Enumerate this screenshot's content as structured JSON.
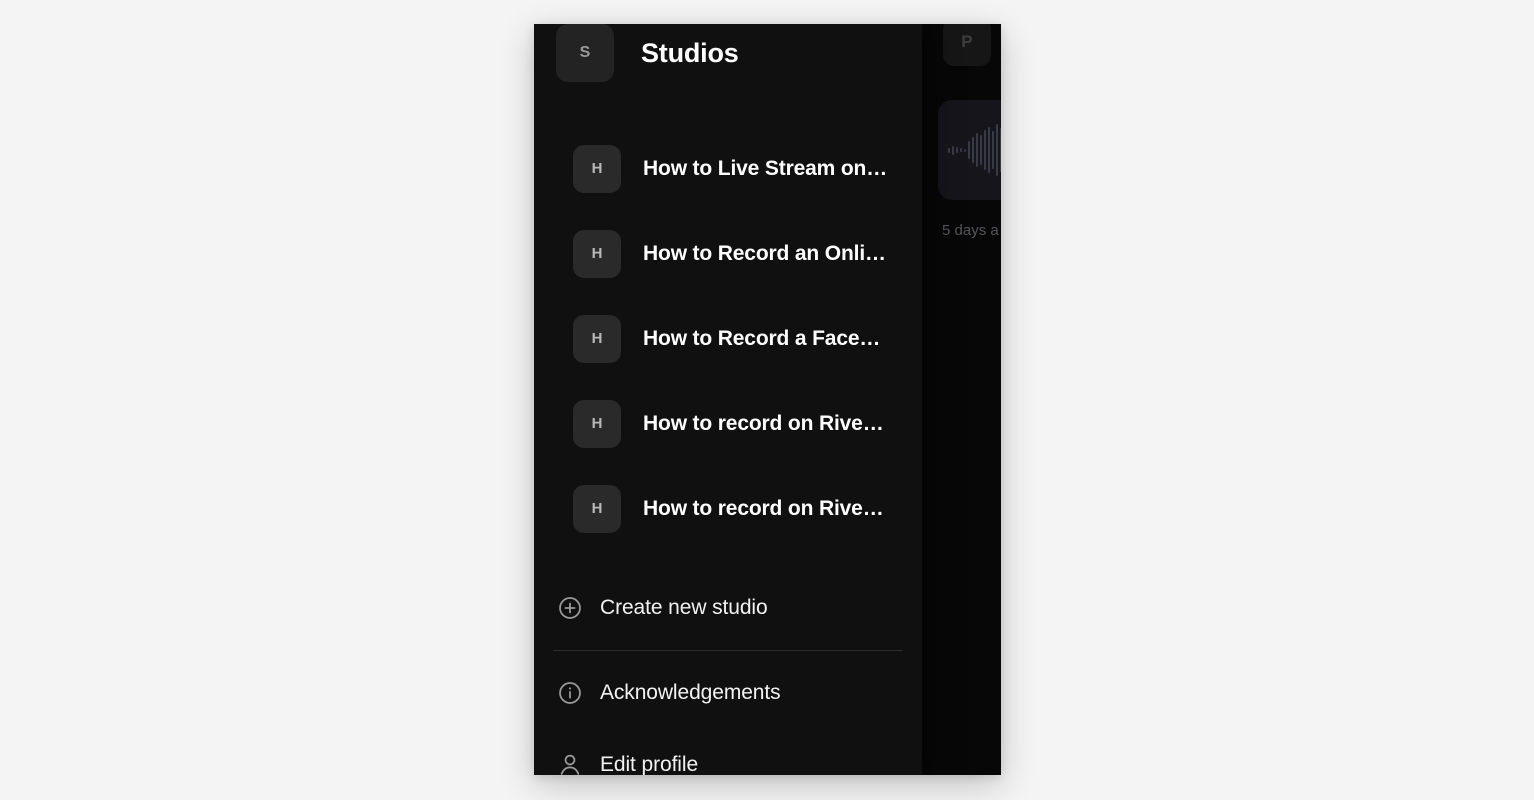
{
  "menu": {
    "header": {
      "avatar_initial": "S",
      "title": "Studios"
    },
    "studios": [
      {
        "badge": "H",
        "label": "How to Live Stream on…"
      },
      {
        "badge": "H",
        "label": "How to Record an Onli…"
      },
      {
        "badge": "H",
        "label": "How to Record a Face…"
      },
      {
        "badge": "H",
        "label": "How to record on Rive…"
      },
      {
        "badge": "H",
        "label": "How to record on Rive…"
      }
    ],
    "create_action": {
      "icon": "plus-circle-icon",
      "label": "Create new studio"
    },
    "footer_actions": [
      {
        "icon": "info-circle-icon",
        "label": "Acknowledgements"
      },
      {
        "icon": "person-icon",
        "label": "Edit profile"
      }
    ]
  },
  "background": {
    "avatar_initial": "P",
    "thumbnail_caption": "5 days a",
    "waveform_icon": "audio-waveform-icon"
  },
  "colors": {
    "page_background": "#f4f4f4",
    "app_background": "#070707",
    "menu_background": "#101010",
    "badge_background": "#2a2a2a",
    "text_primary": "#ffffff",
    "text_muted": "#9c9c9c",
    "divider": "#2b2b2b"
  }
}
